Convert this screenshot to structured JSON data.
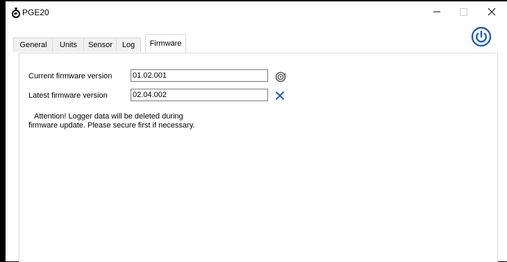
{
  "window": {
    "title": "PGE20"
  },
  "tabs": [
    "General",
    "Units",
    "Sensor",
    "Log",
    "Firmware"
  ],
  "firmware": {
    "current_label": "Current firmware version",
    "current_value": "01.02.001",
    "latest_label": "Latest firmware version",
    "latest_value": "02.04.002",
    "message_line1": "Attention! Logger data will be deleted during",
    "message_line2": "firmware update. Please secure first if necessary."
  },
  "colors": {
    "accent": "#1e5fb4",
    "tab_border": "#d9d9d9"
  },
  "icons": [
    "app-icon",
    "minimize-icon",
    "maximize-icon",
    "close-icon",
    "power-icon",
    "refresh-icon",
    "x-icon"
  ]
}
